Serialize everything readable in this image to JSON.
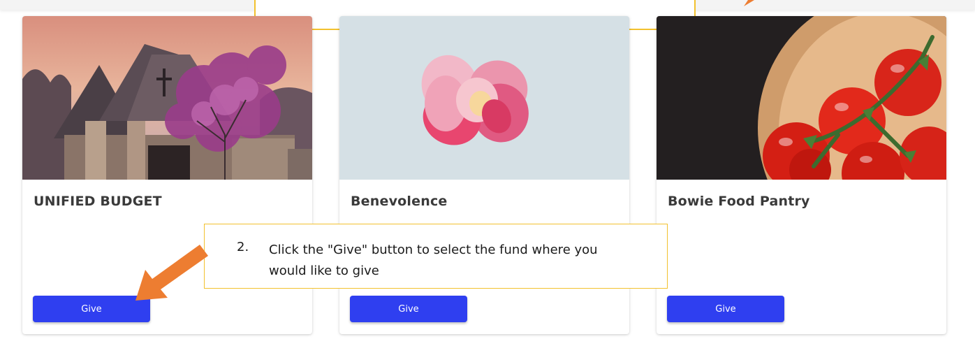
{
  "funds": [
    {
      "title": "UNIFIED BUDGET",
      "button_label": "Give",
      "image_icon": "church-photo"
    },
    {
      "title": "Benevolence",
      "button_label": "Give",
      "image_icon": "flower-photo"
    },
    {
      "title": "Bowie Food Pantry",
      "button_label": "Give",
      "image_icon": "tomatoes-photo"
    }
  ],
  "callout": {
    "number": "2.",
    "text": "Click the \"Give\" button to select the fund where you would like to give"
  },
  "colors": {
    "button": "#2f3ff0",
    "callout_border": "#f2c12e",
    "arrow": "#ed7d31"
  }
}
